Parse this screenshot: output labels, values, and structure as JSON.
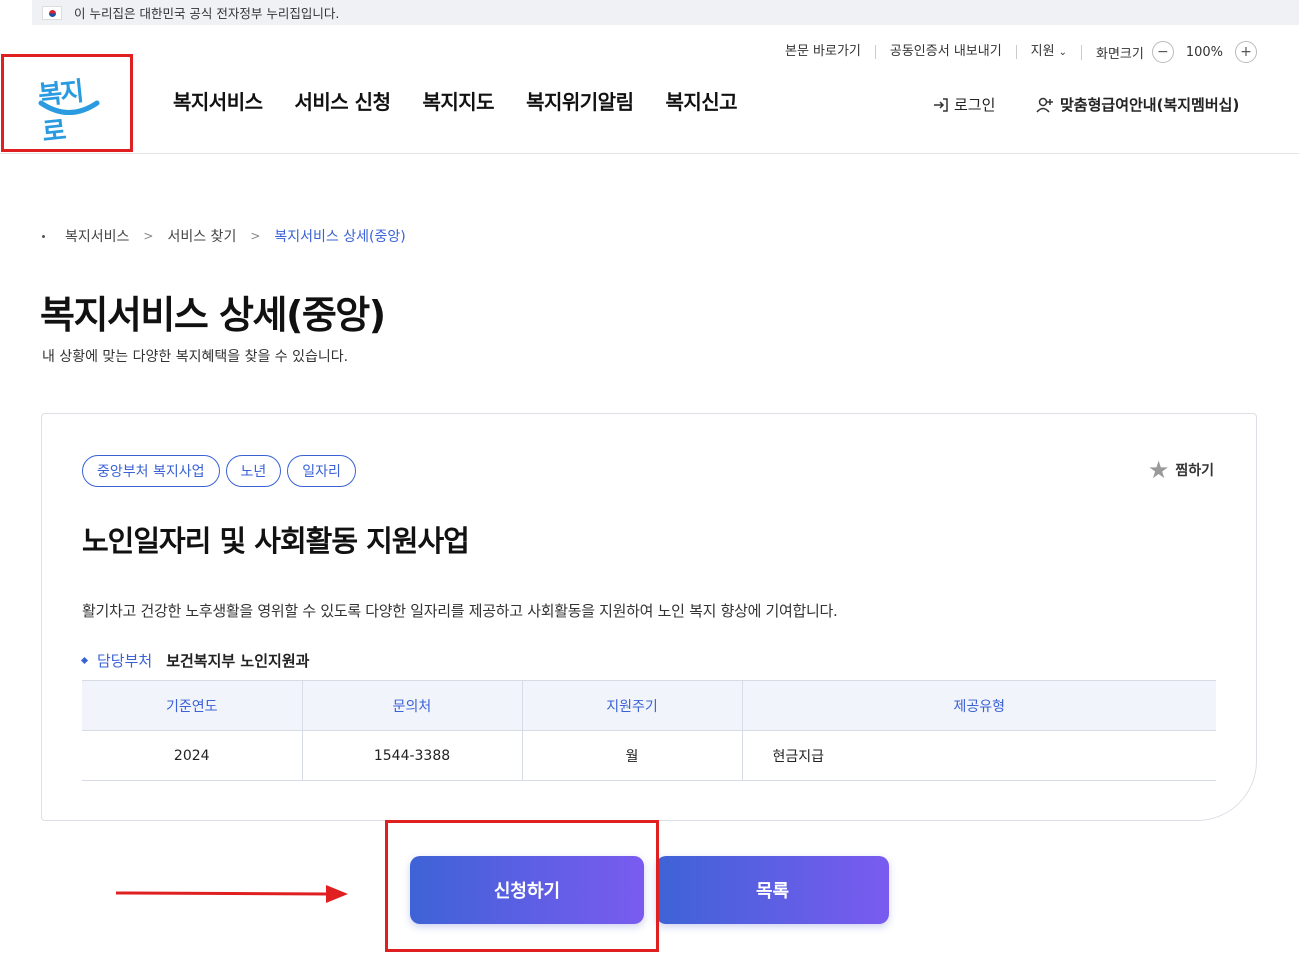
{
  "gov_banner": {
    "text": "이 누리집은 대한민국 공식 전자정부 누리집입니다."
  },
  "utility": {
    "skip": "본문 바로가기",
    "cert": "공동인증서 내보내기",
    "support": "지원",
    "font_size_label": "화면크기",
    "minus": "−",
    "zoom": "100%",
    "plus": "+"
  },
  "logo": {
    "text": "복지로"
  },
  "gnb": [
    "복지서비스",
    "서비스 신청",
    "복지지도",
    "복지위기알림",
    "복지신고"
  ],
  "header": {
    "login": "로그인",
    "membership": "맞춤형급여안내(복지멤버십)"
  },
  "breadcrumb": {
    "items": [
      "복지서비스",
      "서비스 찾기",
      "복지서비스 상세(중앙)"
    ]
  },
  "page": {
    "title": "복지서비스 상세(중앙)",
    "description": "내 상황에 맞는 다양한 복지혜택을 찾을 수 있습니다."
  },
  "service": {
    "tags": [
      "중앙부처 복지사업",
      "노년",
      "일자리"
    ],
    "favorite_label": "찜하기",
    "title": "노인일자리 및 사회활동 지원사업",
    "description": "활기차고 건강한 노후생활을 영위할 수 있도록 다양한 일자리를 제공하고 사회활동을 지원하여 노인 복지 향상에 기여합니다.",
    "dept_label": "담당부처",
    "dept_value": "보건복지부 노인지원과",
    "table": {
      "headers": [
        "기준연도",
        "문의처",
        "지원주기",
        "제공유형"
      ],
      "row": [
        "2024",
        "1544-3388",
        "월",
        "현금지급"
      ]
    }
  },
  "actions": {
    "apply": "신청하기",
    "list": "목록"
  },
  "colors": {
    "accent": "#3a62d6",
    "highlight": "#e02020",
    "button_gradient_start": "#3e63d6",
    "button_gradient_end": "#7a5bf0"
  }
}
